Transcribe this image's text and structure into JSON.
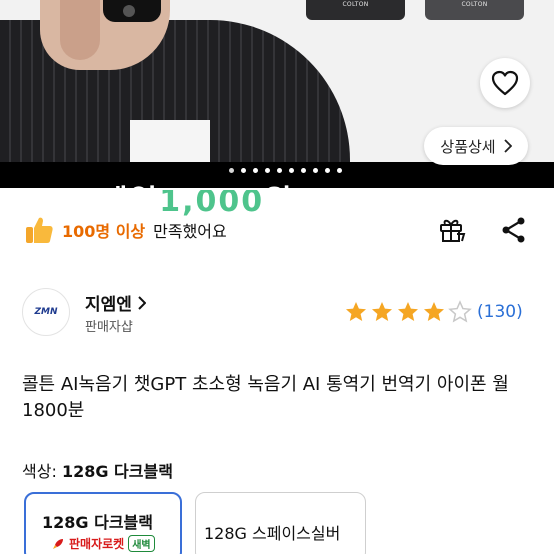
{
  "hero": {
    "product_cards": [
      "COLTON",
      "COLTON"
    ],
    "detail_label": "상품상세",
    "band_text_white": "제일",
    "band_text_green": "1,000",
    "band_text_tail": "원",
    "dots_count": 10,
    "active_dot": 0
  },
  "satisfaction": {
    "count": "100명 이상",
    "text": "만족했어요"
  },
  "seller": {
    "logo_text": "ZMN",
    "name": "지엠엔",
    "sub": "판매자샵",
    "rating": 4,
    "rating_max": 5,
    "review_count": "(130)"
  },
  "product": {
    "title": "콜튼 AI녹음기 챗GPT 초소형 녹음기 AI 통역기 번역기 아이폰 월1800분"
  },
  "options": {
    "label_prefix": "색상:",
    "label_value": "128G 다크블랙",
    "items": [
      {
        "label": "128G 다크블랙",
        "rocket": "판매자로켓",
        "badge": "새벽"
      },
      {
        "label": "128G 스페이스실버"
      }
    ]
  },
  "colors": {
    "accent": "#3a6fd8",
    "review": "#2a6fd6",
    "count_orange": "#e86a00",
    "star": "#f5a623",
    "rocket_red": "#d81b1b",
    "badge_green": "#1f8a3b"
  },
  "icons": {
    "heart": "heart-icon",
    "chevron": "chevron-right-icon",
    "thumb": "thumbs-up-icon",
    "gift": "gift-icon",
    "share": "share-icon"
  }
}
